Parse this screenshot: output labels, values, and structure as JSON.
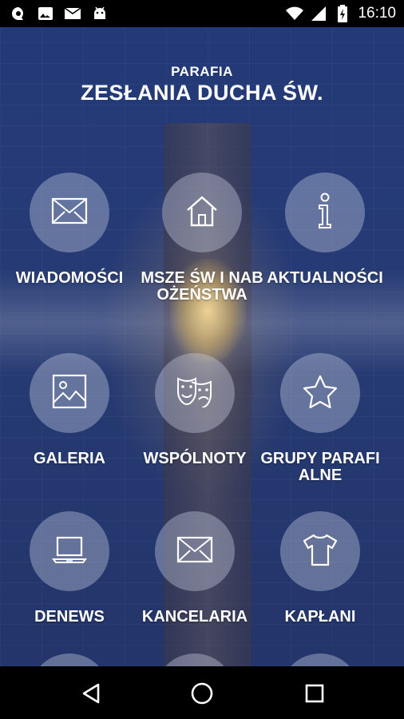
{
  "statusbar": {
    "time": "16:10",
    "left_icons": [
      "chat-notification-icon",
      "image-notification-icon",
      "mail-notification-icon",
      "android-notification-icon"
    ],
    "right_icons": [
      "wifi-icon",
      "signal-icon",
      "battery-icon"
    ]
  },
  "header": {
    "subtitle": "PARAFIA",
    "title": "ZESŁANIA DUCHA ŚW."
  },
  "tiles": [
    {
      "label": "WIADOMOŚCI",
      "icon": "envelope-icon"
    },
    {
      "label": "MSZE ŚW I NABOŻEŃSTWA",
      "icon": "home-icon"
    },
    {
      "label": "AKTUALNOŚCI",
      "icon": "info-icon"
    },
    {
      "label": "GALERIA",
      "icon": "image-icon"
    },
    {
      "label": "WSPÓLNOTY",
      "icon": "theater-masks-icon"
    },
    {
      "label": "GRUPY PARAFIALNE",
      "icon": "star-icon"
    },
    {
      "label": "DENEWS",
      "icon": "laptop-icon"
    },
    {
      "label": "KANCELARIA",
      "icon": "envelope-icon"
    },
    {
      "label": "KAPŁANI",
      "icon": "shirt-icon"
    }
  ],
  "navbar": {
    "buttons": [
      "back-icon",
      "home-icon",
      "recents-icon"
    ]
  }
}
